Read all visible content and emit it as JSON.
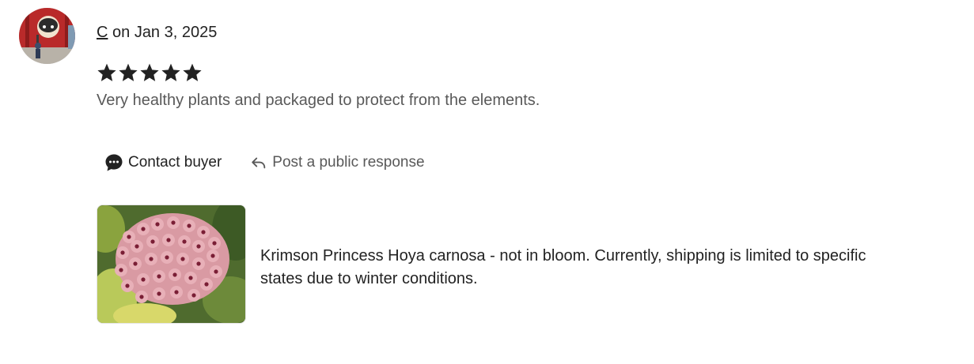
{
  "review": {
    "reviewer_name": "C",
    "date_text": " on Jan 3, 2025",
    "rating": 5,
    "rating_max": 5,
    "text": "Very healthy plants and packaged to protect from the elements."
  },
  "actions": {
    "contact_label": "Contact buyer",
    "contact_icon": "chat-bubble-icon",
    "respond_label": "Post a public response",
    "respond_icon": "reply-arrow-icon"
  },
  "product": {
    "title": "Krimson Princess Hoya carnosa - not in bloom. Currently, shipping is limited to specific states due to winter conditions.",
    "image": "hoya-flower-cluster-photo"
  },
  "colors": {
    "star": "#222222",
    "secondary_text": "#595959",
    "primary_text": "#222222"
  }
}
